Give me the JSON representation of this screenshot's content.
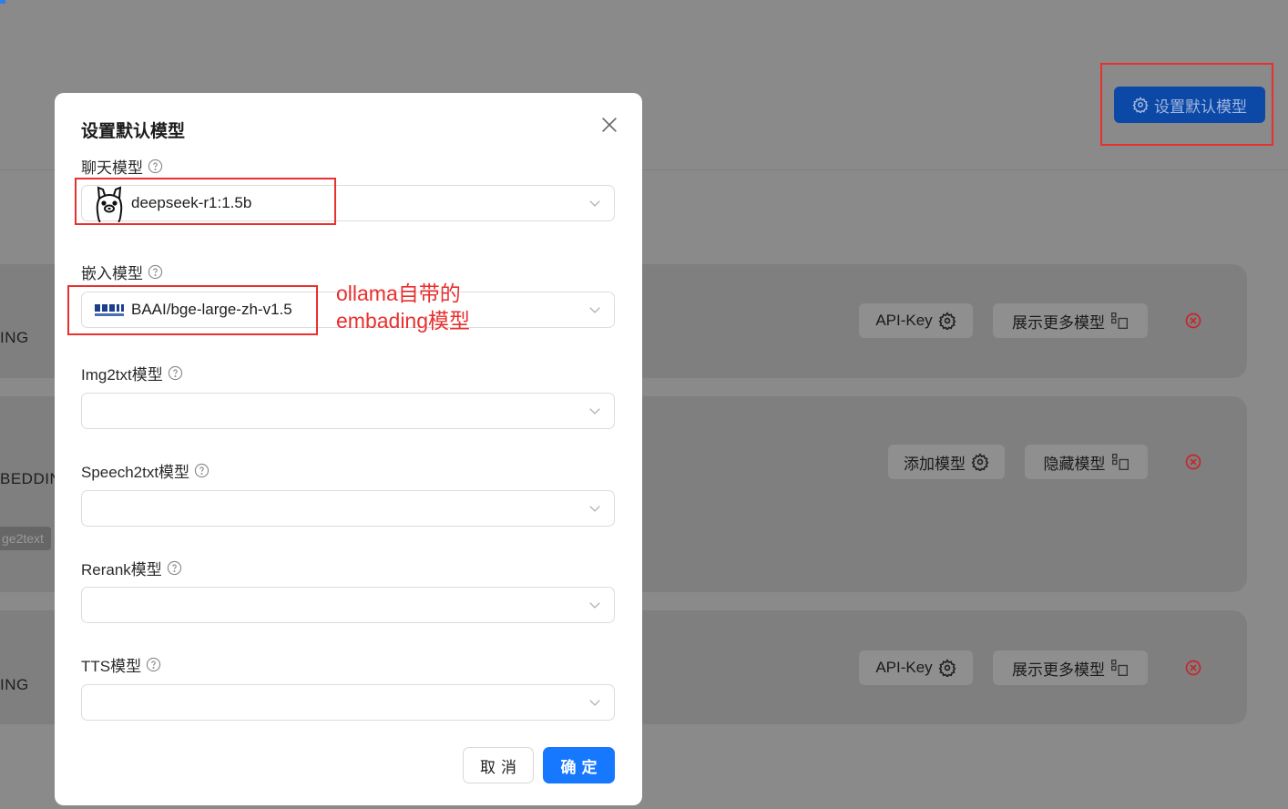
{
  "background": {
    "top_button_label": "设置默认模型",
    "cards": [
      {
        "label": "ING",
        "buttons": [
          "API-Key",
          "展示更多模型"
        ]
      },
      {
        "label": "BEDDIN",
        "tag": "ge2text",
        "buttons": [
          "添加模型",
          "隐藏模型"
        ]
      },
      {
        "label": "ING",
        "buttons": [
          "API-Key",
          "展示更多模型"
        ]
      }
    ]
  },
  "modal": {
    "title": "设置默认模型",
    "fields": [
      {
        "label": "聊天模型",
        "value": "deepseek-r1:1.5b",
        "icon": "ollama-llama-icon"
      },
      {
        "label": "嵌入模型",
        "value": "BAAI/bge-large-zh-v1.5",
        "icon": "baai-logo-icon"
      },
      {
        "label": "Img2txt模型",
        "value": ""
      },
      {
        "label": "Speech2txt模型",
        "value": ""
      },
      {
        "label": "Rerank模型",
        "value": ""
      },
      {
        "label": "TTS模型",
        "value": ""
      }
    ],
    "cancel_label": "取消",
    "ok_label": "确定"
  },
  "annotation": {
    "line1": "ollama自带的",
    "line2": "embading模型"
  },
  "colors": {
    "primary": "#1677ff",
    "annotation_red": "#e8302f",
    "overlay": "#8a8a8a"
  }
}
